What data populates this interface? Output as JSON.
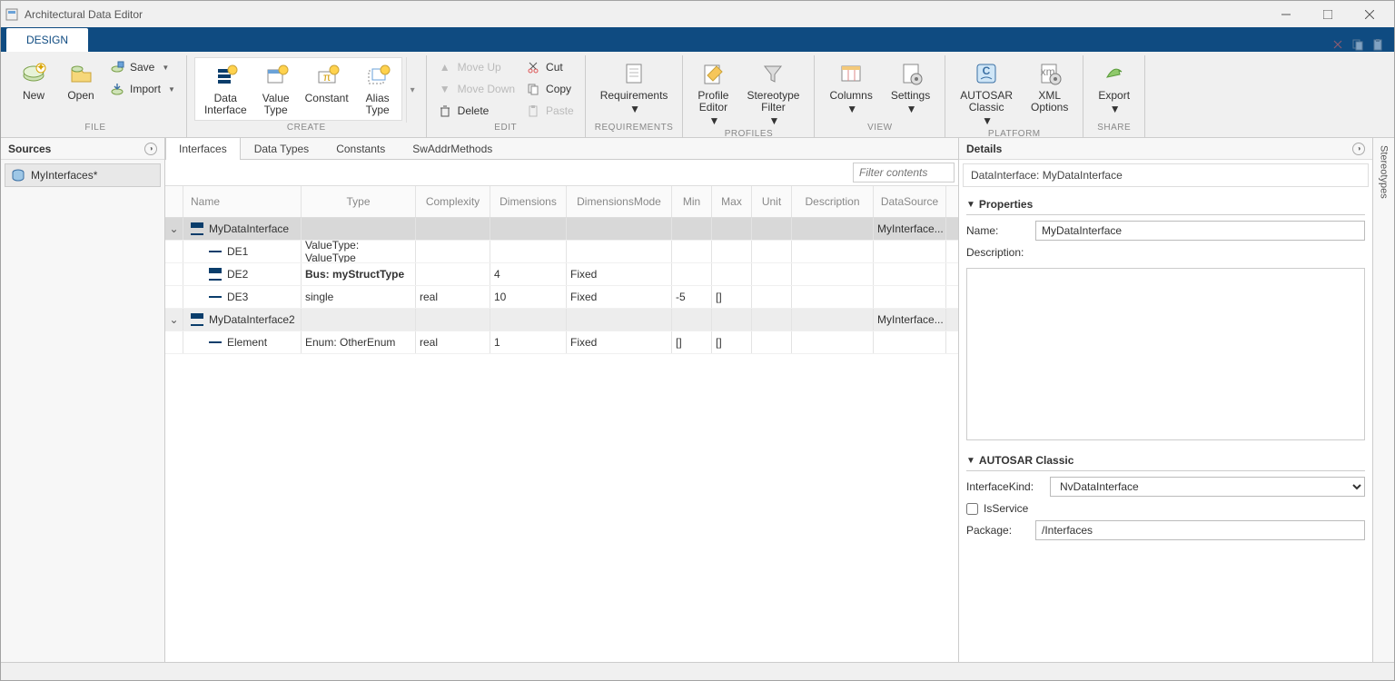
{
  "title": "Architectural Data Editor",
  "designTab": "DESIGN",
  "ribbon": {
    "file": {
      "label": "FILE",
      "new": "New",
      "open": "Open",
      "save": "Save",
      "import": "Import"
    },
    "create": {
      "label": "CREATE",
      "dataInterface": "Data\nInterface",
      "valueType": "Value\nType",
      "constant": "Constant",
      "aliasType": "Alias\nType"
    },
    "edit": {
      "label": "EDIT",
      "moveUp": "Move Up",
      "moveDown": "Move Down",
      "delete": "Delete",
      "cut": "Cut",
      "copy": "Copy",
      "paste": "Paste"
    },
    "requirements": {
      "label": "REQUIREMENTS",
      "btn": "Requirements"
    },
    "profiles": {
      "label": "PROFILES",
      "profileEditor": "Profile\nEditor",
      "stereotypeFilter": "Stereotype\nFilter"
    },
    "view": {
      "label": "VIEW",
      "columns": "Columns",
      "settings": "Settings"
    },
    "platform": {
      "label": "PLATFORM",
      "autosar": "AUTOSAR\nClassic",
      "xml": "XML\nOptions"
    },
    "share": {
      "label": "SHARE",
      "export": "Export"
    }
  },
  "sources": {
    "header": "Sources",
    "item": "MyInterfaces*"
  },
  "subtabs": [
    "Interfaces",
    "Data Types",
    "Constants",
    "SwAddrMethods"
  ],
  "filterPlaceholder": "Filter contents",
  "columns": {
    "name": "Name",
    "type": "Type",
    "complexity": "Complexity",
    "dimensions": "Dimensions",
    "dimmode": "DimensionsMode",
    "min": "Min",
    "max": "Max",
    "unit": "Unit",
    "desc": "Description",
    "ds": "DataSource"
  },
  "rows": [
    {
      "kind": "parent",
      "sel": true,
      "name": "MyDataInterface",
      "ds": "MyInterface..."
    },
    {
      "kind": "child",
      "icon": "single",
      "name": "DE1",
      "type": "ValueType: ValueType"
    },
    {
      "kind": "child",
      "icon": "lines",
      "name": "DE2",
      "type": "Bus: myStructType",
      "typeBold": true,
      "dim": "4",
      "dmode": "Fixed"
    },
    {
      "kind": "child",
      "icon": "single",
      "name": "DE3",
      "type": "single",
      "complexity": "real",
      "dim": "10",
      "dmode": "Fixed",
      "min": "-5",
      "max": "[]"
    },
    {
      "kind": "parent",
      "name": "MyDataInterface2",
      "ds": "MyInterface..."
    },
    {
      "kind": "child",
      "icon": "single",
      "name": "Element",
      "type": "Enum: OtherEnum",
      "complexity": "real",
      "dim": "1",
      "dmode": "Fixed",
      "min": "[]",
      "max": "[]"
    }
  ],
  "details": {
    "header": "Details",
    "subheader": "DataInterface: MyDataInterface",
    "propSection": "Properties",
    "nameLabel": "Name:",
    "nameValue": "MyDataInterface",
    "descLabel": "Description:",
    "autosarSection": "AUTOSAR Classic",
    "ifkLabel": "InterfaceKind:",
    "ifkValue": "NvDataInterface",
    "isServiceLabel": "IsService",
    "pkgLabel": "Package:",
    "pkgValue": "/Interfaces"
  },
  "stereotypes": "Stereotypes"
}
